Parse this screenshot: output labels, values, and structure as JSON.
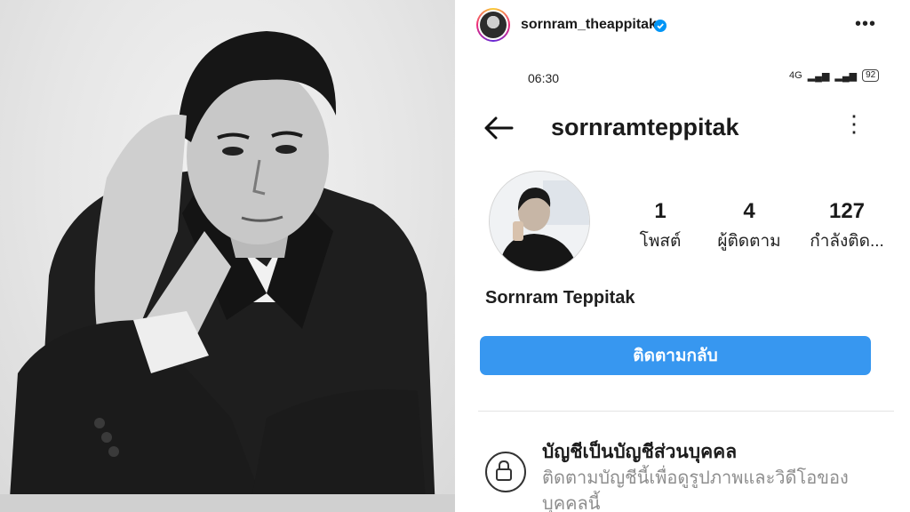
{
  "post": {
    "username": "sornram_theappitak",
    "verified": true,
    "menu_icon": "more-horizontal-icon"
  },
  "status_bar": {
    "time": "06:30",
    "network": "4G",
    "battery": "92"
  },
  "profile": {
    "username": "sornramteppitak",
    "stats": [
      {
        "value": "1",
        "label": "โพสต์"
      },
      {
        "value": "4",
        "label": "ผู้ติดตาม"
      },
      {
        "value": "127",
        "label": "กำลังติด..."
      }
    ],
    "display_name": "Sornram Teppitak",
    "follow_back_label": "ติดตามกลับ",
    "private_title": "บัญชีเป็นบัญชีส่วนบุคคล",
    "private_desc": "ติดตามบัญชีนี้เพื่อดูรูปภาพและวิดีโอของบุคคลนี้"
  },
  "colors": {
    "accent": "#3797f0",
    "verified_badge": "#0095f6"
  }
}
